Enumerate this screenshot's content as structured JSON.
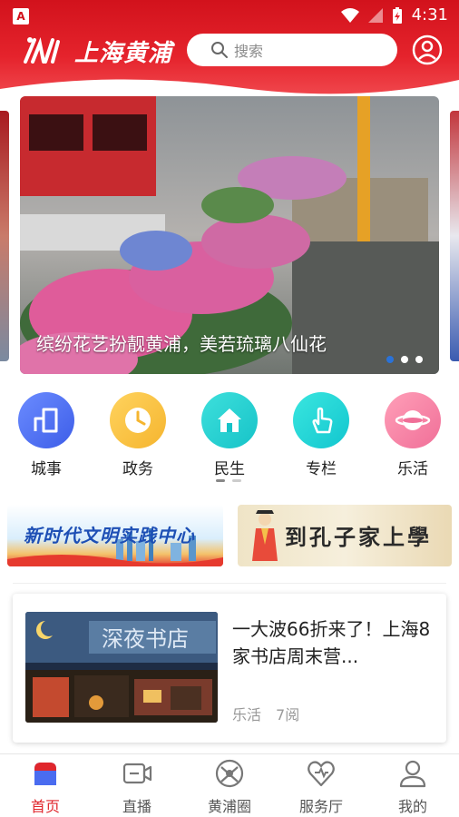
{
  "status_bar": {
    "indicator": "A",
    "time": "4:31"
  },
  "header": {
    "app_title": "上海黄浦",
    "search_placeholder": "搜索",
    "logo_icon": "logo-icon",
    "user_icon": "user-icon"
  },
  "carousel": {
    "caption": "缤纷花艺扮靓黄浦，美若琉璃八仙花",
    "total_slides": 3,
    "active_slide": 1
  },
  "quick_nav": [
    {
      "label": "城事",
      "icon": "city-chart-icon",
      "color": "#4a6cf0"
    },
    {
      "label": "政务",
      "icon": "clock-icon",
      "color": "#f7c443"
    },
    {
      "label": "民生",
      "icon": "home-icon",
      "color": "#1ccfd0"
    },
    {
      "label": "专栏",
      "icon": "hand-pointer-icon",
      "color": "#26cfd6"
    },
    {
      "label": "乐活",
      "icon": "planet-icon",
      "color": "#f78aa8"
    }
  ],
  "banners": {
    "left_text": "新时代文明实践中心",
    "right_text": "到孔子家上學"
  },
  "article": {
    "title": "一大波66折来了！上海8家书店周末营...",
    "category": "乐活",
    "reads": "7阅",
    "thumb_text": "深夜书店"
  },
  "bottom_nav": [
    {
      "label": "首页",
      "icon": "home-tab-icon",
      "active": true
    },
    {
      "label": "直播",
      "icon": "video-icon",
      "active": false
    },
    {
      "label": "黄浦圈",
      "icon": "circle-icon",
      "active": false
    },
    {
      "label": "服务厅",
      "icon": "heart-icon",
      "active": false
    },
    {
      "label": "我的",
      "icon": "profile-icon",
      "active": false
    }
  ],
  "colors": {
    "brand_red": "#e0262c",
    "active_dot": "#2a72d8"
  }
}
